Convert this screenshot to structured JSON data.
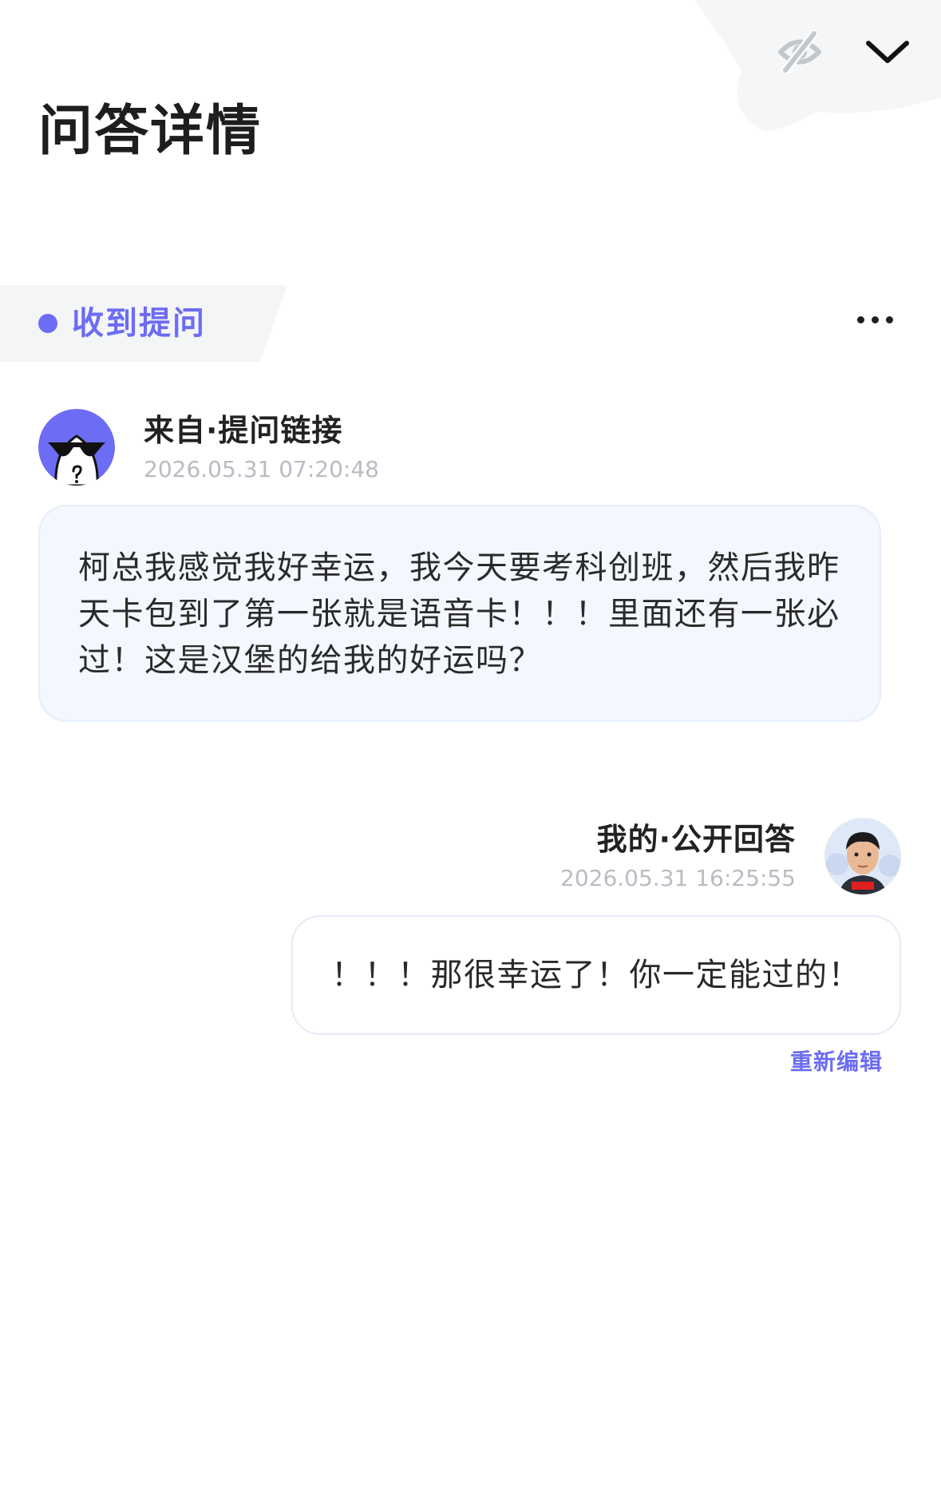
{
  "header": {
    "title": "问答详情",
    "hide_icon": "eye-off-icon",
    "collapse_icon": "chevron-down-icon"
  },
  "section": {
    "tab_label": "收到提问",
    "more_icon": "more-horizontal-icon",
    "accent_color": "#6c6cf5"
  },
  "question": {
    "source_label": "来自·提问链接",
    "timestamp": "2026.05.31 07:20:48",
    "text": "柯总我感觉我好幸运，我今天要考科创班，然后我昨天卡包到了第一张就是语音卡！！！里面还有一张必过！这是汉堡的给我的好运吗？",
    "avatar_icon": "anonymous-sunglasses-avatar",
    "avatar_color": "#6c6cf5"
  },
  "answer": {
    "source_label": "我的·公开回答",
    "timestamp": "2026.05.31 16:25:55",
    "text": "！！！那很幸运了！你一定能过的！",
    "avatar_icon": "user-photo-avatar",
    "reedit_label": "重新编辑"
  }
}
